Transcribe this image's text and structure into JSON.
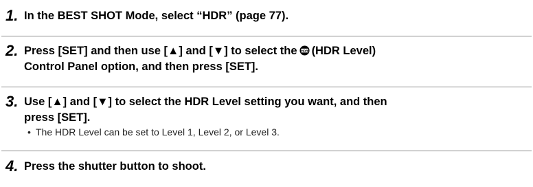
{
  "steps": [
    {
      "number": "1.",
      "text": "In the BEST SHOT Mode, select “HDR” (page 77)."
    },
    {
      "number": "2.",
      "text_before_icon": "Press [SET] and then use [▲] and [▼] to select the",
      "icon": "hdr-level-icon",
      "text_after_icon": "(HDR Level)",
      "text_line2": "Control Panel option, and then press [SET]."
    },
    {
      "number": "3.",
      "text_line1": "Use [▲] and [▼] to select the HDR Level setting you want, and then",
      "text_line2": "press [SET].",
      "bullet": "•",
      "note": "The HDR Level can be set to Level 1, Level 2, or Level 3."
    },
    {
      "number": "4.",
      "text": "Press the shutter button to shoot."
    }
  ]
}
